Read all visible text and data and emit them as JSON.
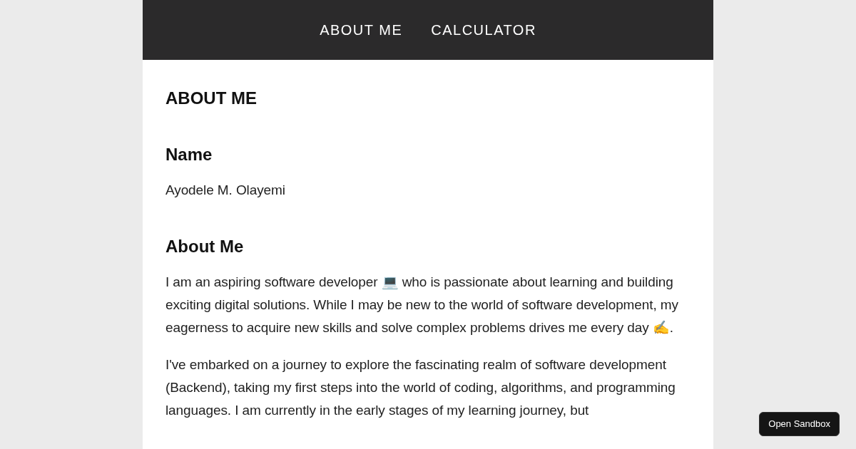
{
  "nav": {
    "links": [
      {
        "label": "ABOUT ME"
      },
      {
        "label": "CALCULATOR"
      }
    ]
  },
  "page_title": "ABOUT ME",
  "sections": [
    {
      "heading": "Name",
      "paragraphs": [
        "Ayodele M. Olayemi"
      ]
    },
    {
      "heading": "About Me",
      "paragraphs": [
        "I am an aspiring software developer 💻 who is passionate about learning and building exciting digital solutions. While I may be new to the world of software development, my eagerness to acquire new skills and solve complex problems drives me every day ✍️.",
        "I've embarked on a journey to explore the fascinating realm of software development (Backend), taking my first steps into the world of coding, algorithms, and programming languages. I am currently in the early stages of my learning journey, but"
      ]
    }
  ],
  "sandbox_button": "Open Sandbox"
}
